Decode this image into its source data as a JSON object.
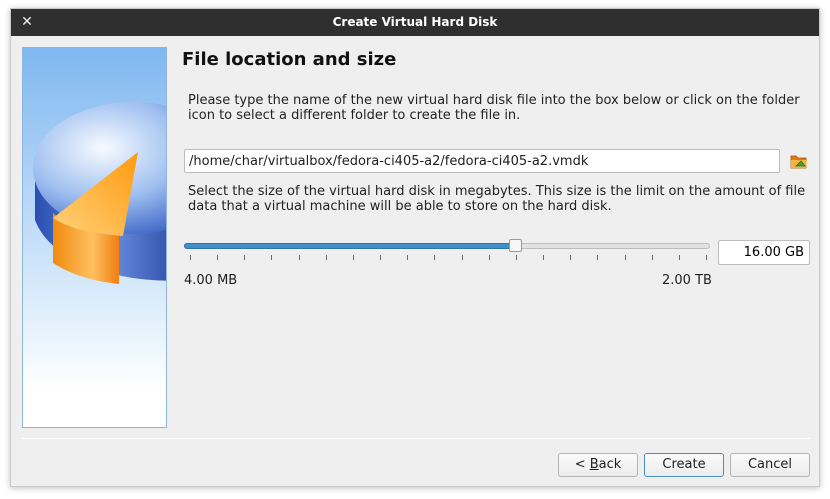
{
  "window": {
    "title": "Create Virtual Hard Disk",
    "close_glyph": "✕"
  },
  "page": {
    "heading": "File location and size",
    "location_description": "Please type the name of the new virtual hard disk file into the box below or click on the folder icon to select a different folder to create the file in.",
    "file_path": "/home/char/virtualbox/fedora-ci405-a2/fedora-ci405-a2.vmdk",
    "folder_icon": "folder-choose-icon",
    "size_description": "Select the size of the virtual hard disk in megabytes. This size is the limit on the amount of file data that a virtual machine will be able to store on the hard disk.",
    "size_value": "16.00 GB",
    "size_slider_fraction": 0.63,
    "size_min": "4.00 MB",
    "size_max": "2.00 TB"
  },
  "buttons": {
    "back_prefix": "< ",
    "back_mnemonic": "B",
    "back_rest": "ack",
    "create": "Create",
    "cancel": "Cancel"
  },
  "colors": {
    "slider_fill": "#3f8fcb",
    "titlebar": "#2f2f2f"
  }
}
